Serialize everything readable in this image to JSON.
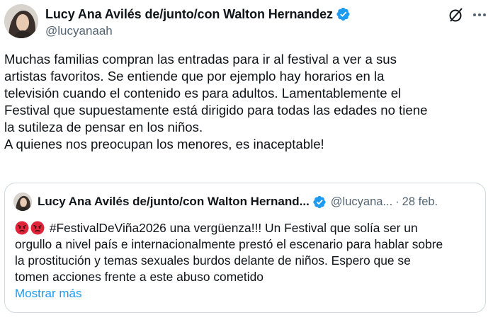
{
  "author": {
    "name": "Lucy Ana Avilés de/junto/con Walton Hernandez",
    "handle": "@lucyanaah"
  },
  "icons": {
    "verified": "verified-badge-icon",
    "grok": "grok-icon",
    "more": "more-icon",
    "emoji": "angry-face-emoji"
  },
  "colors": {
    "accent": "#1d9bf0",
    "secondary_text": "#536471",
    "border": "#cfd9de"
  },
  "tweet": {
    "paragraphs": [
      "Muchas familias compran las entradas para ir al festival a ver a sus",
      "artistas favoritos. Se entiende que por ejemplo hay horarios en la",
      "televisión cuando el contenido es para adultos. Lamentablemente el",
      "Festival que supuestamente está dirigido para todas las edades no tiene",
      "la sutileza de pensar en los niños.",
      "A quienes nos preocupan los menores, es inaceptable!"
    ]
  },
  "quoted": {
    "name": "Lucy Ana Avilés de/junto/con Walton Hernand...",
    "handle": "@lucyana...",
    "separator": "·",
    "date": "28 feb.",
    "lines": [
      "#FestivalDeViña2026 una vergüenza!!! Un Festival que solía ser un",
      "orgullo a nivel país e internacionalmente prestó el escenario para hablar sobre",
      "la prostitución y temas sexuales burdos delante de niños. Espero que se",
      "tomen acciones frente a este abuso cometido"
    ],
    "show_more": "Mostrar más"
  }
}
